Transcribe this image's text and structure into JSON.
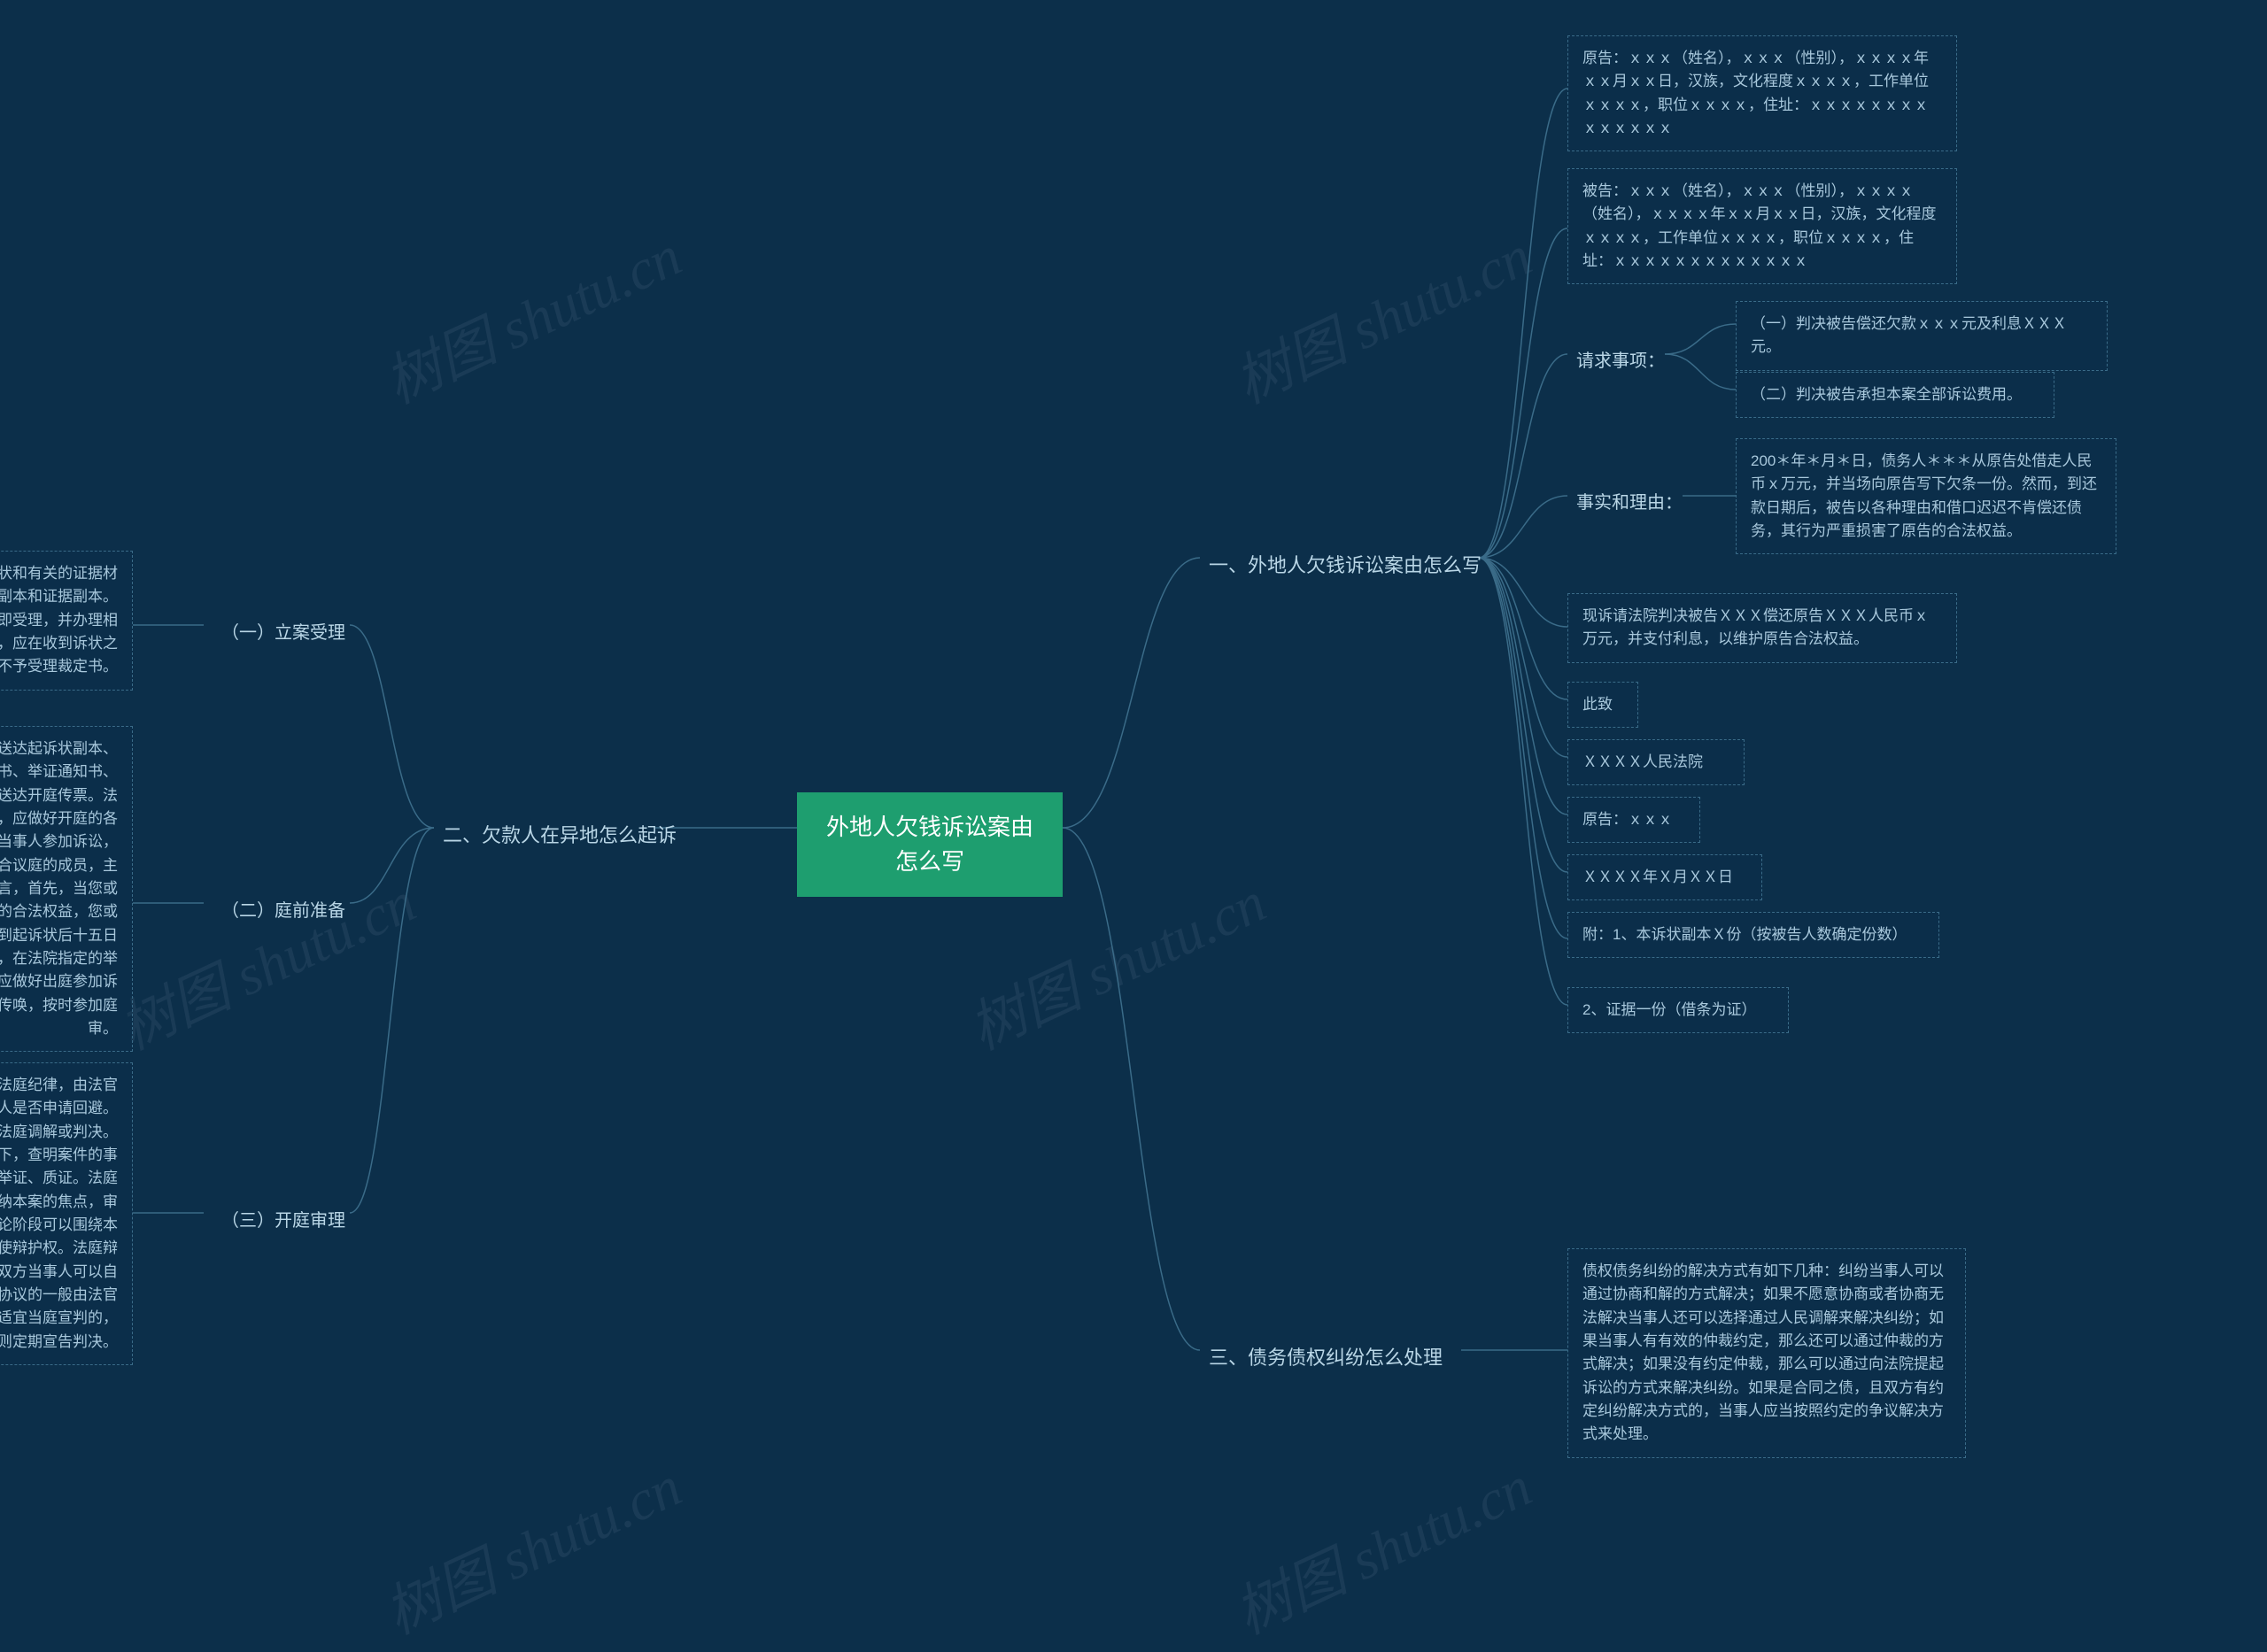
{
  "watermark": "树图 shutu.cn",
  "root": "外地人欠钱诉讼案由怎么写",
  "branch1": {
    "title": "一、外地人欠钱诉讼案由怎么写",
    "leaves": {
      "plaintiff": "原告：ｘｘｘ（姓名），ｘｘｘ（性别），ｘｘｘｘ年ｘｘ月ｘｘ日，汉族，文化程度ｘｘｘｘ，工作单位ｘｘｘｘ，职位ｘｘｘｘ，住址：ｘｘｘｘｘｘｘｘｘｘｘｘｘｘ",
      "defendant": "被告：ｘｘｘ（姓名），ｘｘｘ（性别），ｘｘｘｘ（姓名），ｘｘｘｘ年ｘｘ月ｘｘ日，汉族，文化程度ｘｘｘｘ，工作单位ｘｘｘｘ，职位ｘｘｘｘ，住址：ｘｘｘｘｘｘｘｘｘｘｘｘｘ",
      "request_label": "请求事项：",
      "request1": "（一）判决被告偿还欠款ｘｘｘ元及利息ＸＸＸ元。",
      "request2": "（二）判决被告承担本案全部诉讼费用。",
      "facts_label": "事实和理由：",
      "facts": "200＊年＊月＊日，债务人＊＊＊从原告处借走人民币ｘ万元，并当场向原告写下欠条一份。然而，到还款日期后，被告以各种理由和借口迟迟不肯偿还债务，其行为严重损害了原告的合法权益。",
      "conclusion": "现诉请法院判决被告ＸＸＸ偿还原告ＸＸＸ人民币ｘ万元，并支付利息，以维护原告合法权益。",
      "cizhi": "此致",
      "court": "ＸＸＸＸ人民法院",
      "plaintiff_sign": "原告：ｘｘｘ",
      "date": "ＸＸＸＸ年Ｘ月ＸＸ日",
      "attach1": "附：1、本诉状副本Ｘ份（按被告人数确定份数）",
      "attach2": "2、证据一份（借条为证）"
    }
  },
  "branch2": {
    "title": "二、欠款人在异地怎么起诉",
    "subs": {
      "s1": "（一）立案受理",
      "s2": "（二）庭前准备",
      "s3": "（三）开庭审理"
    },
    "leaves": {
      "l1": "原告向法院起诉，应递交起诉状和有关的证据材料，并按照被告人数递交起诉状副本和证据副本。经审查，符合受理条件的，应当即受理，并办理相关立案手续。不符合受理条件的，应在收到诉状之日起七日内向原告送达不予受理裁定书。",
      "l2": "法院在受理案件后五日内向被告送达起诉状副本、应诉通知书、诉讼权利义务告知书、举证通知书、开庭传票。被告应诉后，向原告送达开庭传票。法院在依法传唤双方当事人的同时，应做好开庭的各种准备，如通知必须共同诉讼的当事人参加诉讼，调查必要的证据，向当事人告知合议庭的成员，主持庭前交换证据等。对当事人而言，首先，当您或您单位被起诉后，为了维护自身的合法权益，您或您单位应当依法应诉，并应在收到起诉状后十五日内向人民法院提交答辩状及副本，在法院指定的举证期间内提交相关证据。其次，应做好出庭参加诉讼的各种准备，依照人民法院的传唤，按时参加庭审。",
      "l3": "开庭审理时，首先由书记员宣布法庭纪律，由法官查明当事人到庭情况并询问当事人是否申请回避。开庭分为法庭调查、法庭辩论、法庭调解或判决。法庭调查主要是在法官的主导下，查明案件的事实，当事人在此阶段应当充分的举证、质证。法庭调查结束后法官根据案件情况归纳本案的焦点，审理即转入辩论阶段。当事人在辩论阶段可以围绕本案焦点阐述自己的观点，充分行使辩护权。法庭辩论结束后，在法官主持下调解，双方当事人可以自愿达成调解协议，无法达成调解协议的一般由法官当庭作出判决。如果案件复杂不适宜当庭宣判的，则定期宣告判决。"
    }
  },
  "branch3": {
    "title": "三、债务债权纠纷怎么处理",
    "leaf": "债权债务纠纷的解决方式有如下几种：纠纷当事人可以通过协商和解的方式解决；如果不愿意协商或者协商无法解决当事人还可以选择通过人民调解来解决纠纷；如果当事人有有效的仲裁约定，那么还可以通过仲裁的方式解决；如果没有约定仲裁，那么可以通过向法院提起诉讼的方式来解决纠纷。如果是合同之债，且双方有约定纠纷解决方式的，当事人应当按照约定的争议解决方式来处理。"
  }
}
